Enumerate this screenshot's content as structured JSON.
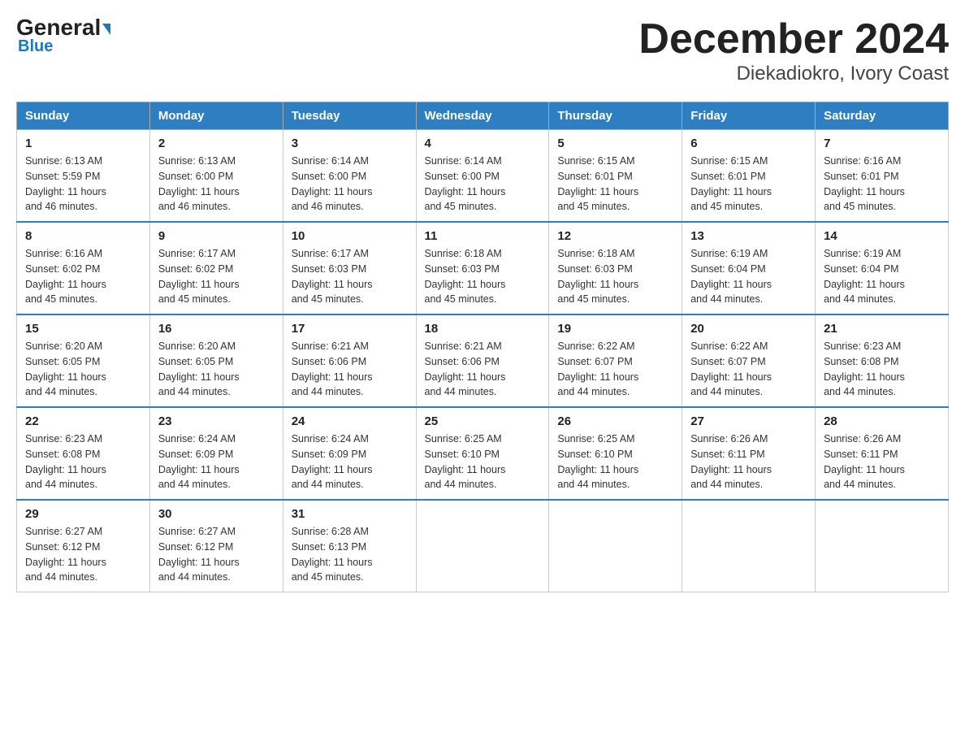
{
  "logo": {
    "name_part1": "General",
    "name_part2": "Blue"
  },
  "title": "December 2024",
  "subtitle": "Diekadiokro, Ivory Coast",
  "days_of_week": [
    "Sunday",
    "Monday",
    "Tuesday",
    "Wednesday",
    "Thursday",
    "Friday",
    "Saturday"
  ],
  "weeks": [
    [
      {
        "day": "1",
        "sunrise": "6:13 AM",
        "sunset": "5:59 PM",
        "daylight": "11 hours and 46 minutes."
      },
      {
        "day": "2",
        "sunrise": "6:13 AM",
        "sunset": "6:00 PM",
        "daylight": "11 hours and 46 minutes."
      },
      {
        "day": "3",
        "sunrise": "6:14 AM",
        "sunset": "6:00 PM",
        "daylight": "11 hours and 46 minutes."
      },
      {
        "day": "4",
        "sunrise": "6:14 AM",
        "sunset": "6:00 PM",
        "daylight": "11 hours and 45 minutes."
      },
      {
        "day": "5",
        "sunrise": "6:15 AM",
        "sunset": "6:01 PM",
        "daylight": "11 hours and 45 minutes."
      },
      {
        "day": "6",
        "sunrise": "6:15 AM",
        "sunset": "6:01 PM",
        "daylight": "11 hours and 45 minutes."
      },
      {
        "day": "7",
        "sunrise": "6:16 AM",
        "sunset": "6:01 PM",
        "daylight": "11 hours and 45 minutes."
      }
    ],
    [
      {
        "day": "8",
        "sunrise": "6:16 AM",
        "sunset": "6:02 PM",
        "daylight": "11 hours and 45 minutes."
      },
      {
        "day": "9",
        "sunrise": "6:17 AM",
        "sunset": "6:02 PM",
        "daylight": "11 hours and 45 minutes."
      },
      {
        "day": "10",
        "sunrise": "6:17 AM",
        "sunset": "6:03 PM",
        "daylight": "11 hours and 45 minutes."
      },
      {
        "day": "11",
        "sunrise": "6:18 AM",
        "sunset": "6:03 PM",
        "daylight": "11 hours and 45 minutes."
      },
      {
        "day": "12",
        "sunrise": "6:18 AM",
        "sunset": "6:03 PM",
        "daylight": "11 hours and 45 minutes."
      },
      {
        "day": "13",
        "sunrise": "6:19 AM",
        "sunset": "6:04 PM",
        "daylight": "11 hours and 44 minutes."
      },
      {
        "day": "14",
        "sunrise": "6:19 AM",
        "sunset": "6:04 PM",
        "daylight": "11 hours and 44 minutes."
      }
    ],
    [
      {
        "day": "15",
        "sunrise": "6:20 AM",
        "sunset": "6:05 PM",
        "daylight": "11 hours and 44 minutes."
      },
      {
        "day": "16",
        "sunrise": "6:20 AM",
        "sunset": "6:05 PM",
        "daylight": "11 hours and 44 minutes."
      },
      {
        "day": "17",
        "sunrise": "6:21 AM",
        "sunset": "6:06 PM",
        "daylight": "11 hours and 44 minutes."
      },
      {
        "day": "18",
        "sunrise": "6:21 AM",
        "sunset": "6:06 PM",
        "daylight": "11 hours and 44 minutes."
      },
      {
        "day": "19",
        "sunrise": "6:22 AM",
        "sunset": "6:07 PM",
        "daylight": "11 hours and 44 minutes."
      },
      {
        "day": "20",
        "sunrise": "6:22 AM",
        "sunset": "6:07 PM",
        "daylight": "11 hours and 44 minutes."
      },
      {
        "day": "21",
        "sunrise": "6:23 AM",
        "sunset": "6:08 PM",
        "daylight": "11 hours and 44 minutes."
      }
    ],
    [
      {
        "day": "22",
        "sunrise": "6:23 AM",
        "sunset": "6:08 PM",
        "daylight": "11 hours and 44 minutes."
      },
      {
        "day": "23",
        "sunrise": "6:24 AM",
        "sunset": "6:09 PM",
        "daylight": "11 hours and 44 minutes."
      },
      {
        "day": "24",
        "sunrise": "6:24 AM",
        "sunset": "6:09 PM",
        "daylight": "11 hours and 44 minutes."
      },
      {
        "day": "25",
        "sunrise": "6:25 AM",
        "sunset": "6:10 PM",
        "daylight": "11 hours and 44 minutes."
      },
      {
        "day": "26",
        "sunrise": "6:25 AM",
        "sunset": "6:10 PM",
        "daylight": "11 hours and 44 minutes."
      },
      {
        "day": "27",
        "sunrise": "6:26 AM",
        "sunset": "6:11 PM",
        "daylight": "11 hours and 44 minutes."
      },
      {
        "day": "28",
        "sunrise": "6:26 AM",
        "sunset": "6:11 PM",
        "daylight": "11 hours and 44 minutes."
      }
    ],
    [
      {
        "day": "29",
        "sunrise": "6:27 AM",
        "sunset": "6:12 PM",
        "daylight": "11 hours and 44 minutes."
      },
      {
        "day": "30",
        "sunrise": "6:27 AM",
        "sunset": "6:12 PM",
        "daylight": "11 hours and 44 minutes."
      },
      {
        "day": "31",
        "sunrise": "6:28 AM",
        "sunset": "6:13 PM",
        "daylight": "11 hours and 45 minutes."
      },
      null,
      null,
      null,
      null
    ]
  ],
  "labels": {
    "sunrise": "Sunrise:",
    "sunset": "Sunset:",
    "daylight": "Daylight:"
  }
}
